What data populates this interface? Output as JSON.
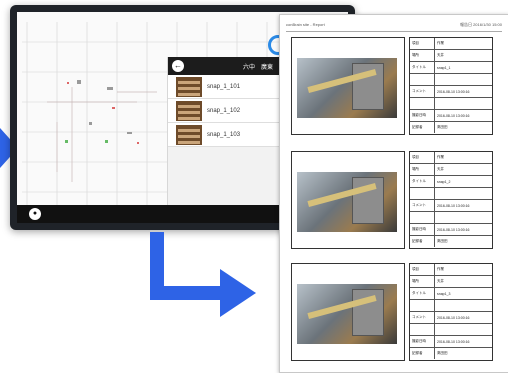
{
  "tablet": {
    "panel": {
      "title": "六中　廣東",
      "snapshots": [
        "snap_1_101",
        "snap_1_102",
        "snap_1_103"
      ]
    }
  },
  "report": {
    "header_left": "conBrain site - Report",
    "header_right": "報告日 2016/1/30 15:00",
    "table_keys": [
      "項目",
      "場所",
      "タイトル",
      "",
      "コメント",
      "",
      "撮影日時",
      "記録者",
      ""
    ],
    "blocks": [
      {
        "values": [
          "作業",
          "天井",
          "snap1_1",
          "",
          "2016-08-10 13:00:16",
          "",
          "2016-08-10 13:00:16",
          "髙田田",
          ""
        ]
      },
      {
        "values": [
          "作業",
          "天井",
          "snap1_2",
          "",
          "2016-08-10 13:00:16",
          "",
          "2016-08-10 13:00:16",
          "髙田田",
          ""
        ]
      },
      {
        "values": [
          "作業",
          "天井",
          "snap1_3",
          "",
          "2016-08-10 13:00:16",
          "",
          "2016-08-10 13:00:16",
          "髙田田",
          ""
        ]
      }
    ]
  },
  "colors": {
    "arrow": "#2e63e6",
    "tablet_frame": "#1f2329"
  }
}
